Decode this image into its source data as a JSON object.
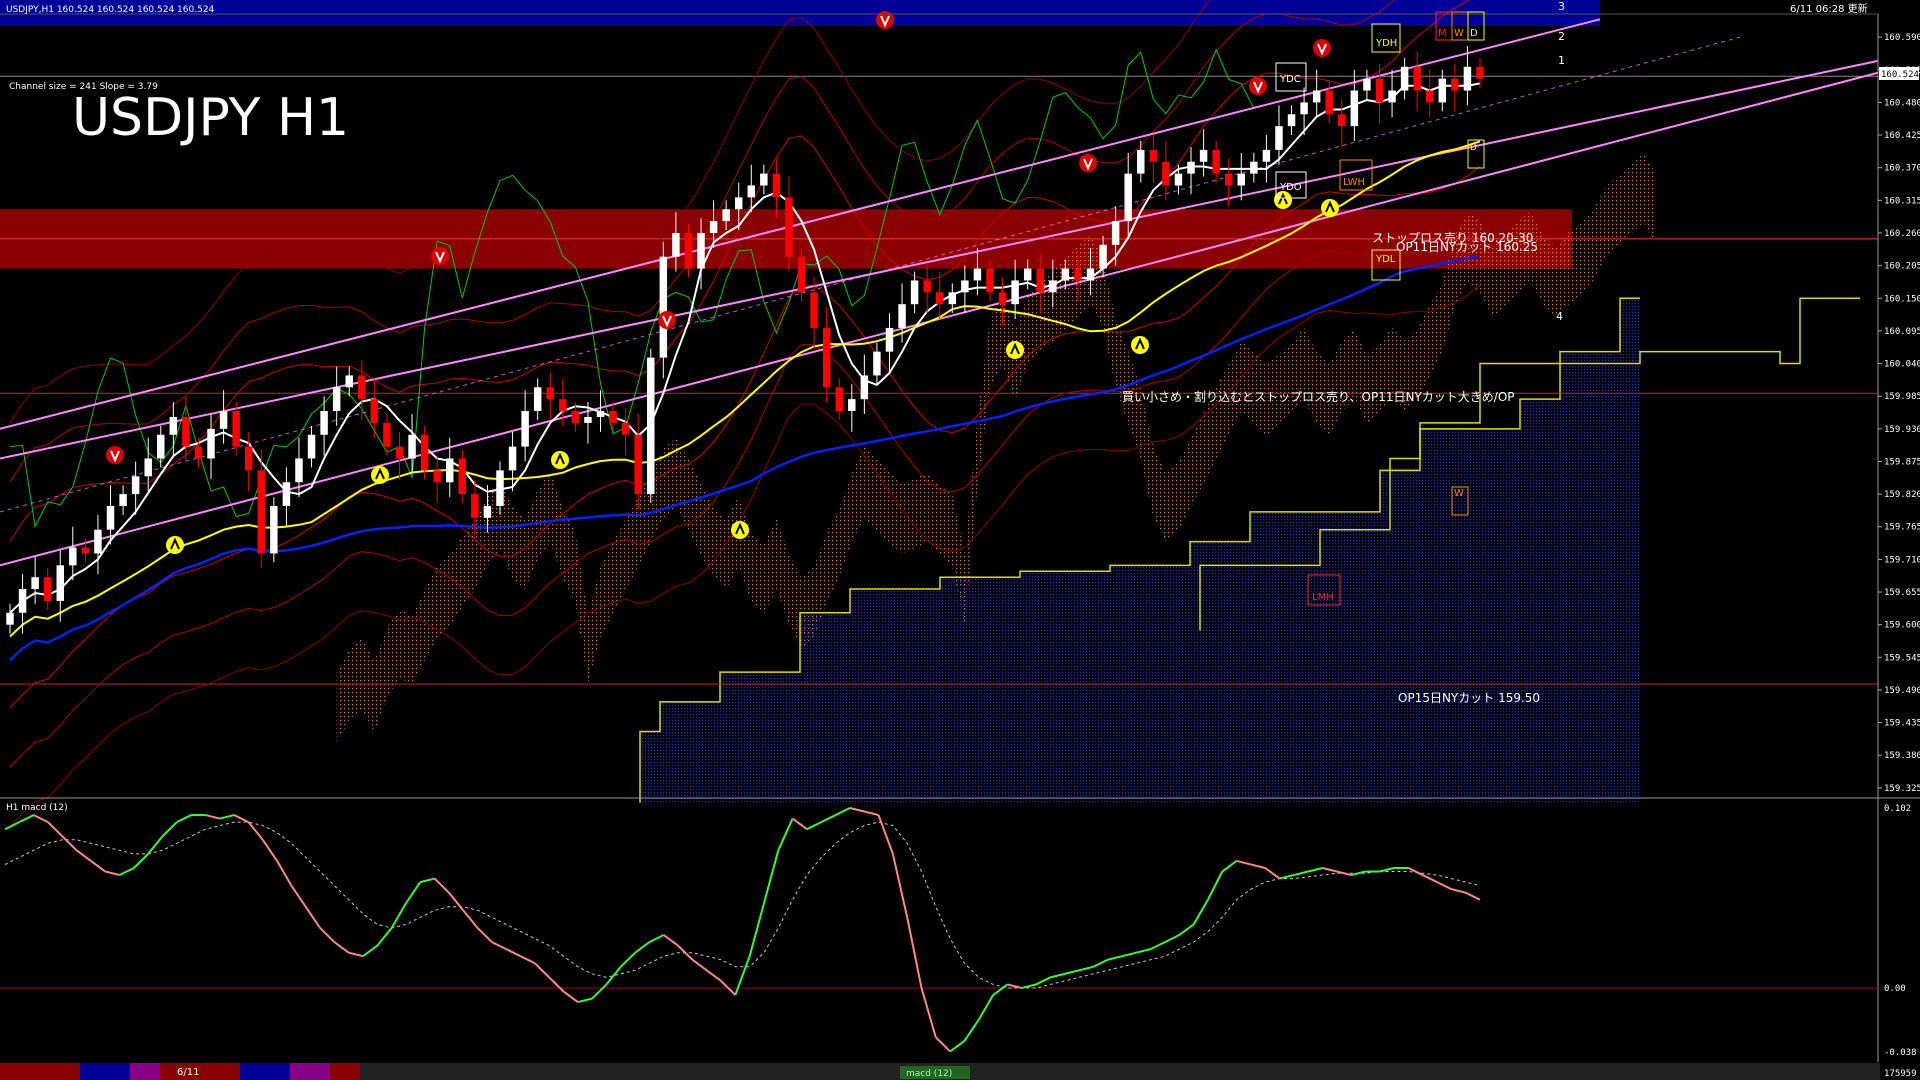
{
  "header": {
    "symbol_info": "USDJPY,H1  160.524 160.524 160.524 160.524",
    "datetime": "6/11 06:28 更新",
    "channel_info": "Channel size = 241 Slope = 3.79",
    "big_title": "USDJPY H1"
  },
  "annotations": {
    "stoploss_sell": "ストップロス売り 160.20-30",
    "op11_cut": "OP11日NYカット 160.25",
    "strategy": "買い小さめ・割り込むとストップロス売り、OP11日NYカット大きめ/OP",
    "op15_cut": "OP15日NYカット 159.50",
    "label_ydh": "YDH",
    "label_ydc": "YDC",
    "label_ydo": "YDO",
    "label_ydl": "YDL",
    "label_lwh": "LWH",
    "label_lmh": "LMH",
    "label_w": "W",
    "label_m": "M",
    "label_d": "D",
    "ch_1": "1",
    "ch_2": "2",
    "ch_3": "3",
    "ch_4": "4"
  },
  "macd_panel": {
    "title": "H1  macd (12)",
    "max_label": "0.102",
    "zero_label": "0.00",
    "min_label": "-0.038",
    "bottom_tab_date": "6/11",
    "bottom_tab_name": "macd (12)",
    "bottom_counter": "175959"
  },
  "colors": {
    "background": "#000000",
    "bull_candle": "#ffffff",
    "bear_candle": "#ff0000",
    "red_zone": "#8b0000",
    "top_bar": "#000099",
    "ma_white": "#ffffff",
    "ma_yellow": "#ffff00",
    "ma_blue": "#0022ff",
    "channel": "#ff88ff",
    "chikou": "#00cc00",
    "kumo_blue": "#1a3aff",
    "kumo_orange": "#ff8844",
    "macd_up": "#33ff33",
    "macd_down": "#ff8888"
  },
  "chart_data": [
    {
      "type": "candlestick",
      "title": "USDJPY H1",
      "ylim": [
        159.3,
        160.62
      ],
      "y_ticks": [
        "160.590",
        "160.535",
        "160.480",
        "160.425",
        "160.370",
        "160.315",
        "160.260",
        "160.205",
        "160.150",
        "160.095",
        "160.040",
        "159.985",
        "159.930",
        "159.875",
        "159.820",
        "159.765",
        "159.710",
        "159.655",
        "159.600",
        "159.545",
        "159.490",
        "159.435",
        "159.380",
        "159.325"
      ],
      "current_price": "160.524",
      "horizontal_levels": [
        {
          "label": "ストップロス売り 160.20-30",
          "from": 160.2,
          "to": 160.3
        },
        {
          "label": "OP11日NYカット 160.25",
          "value": 160.25
        },
        {
          "label": "OP15日NYカット 159.50",
          "value": 159.5
        },
        {
          "label": "",
          "value": 159.99
        }
      ],
      "candles_close": [
        159.62,
        159.66,
        159.68,
        159.64,
        159.7,
        159.73,
        159.72,
        159.76,
        159.8,
        159.82,
        159.85,
        159.88,
        159.92,
        159.95,
        159.9,
        159.88,
        159.93,
        159.96,
        159.9,
        159.86,
        159.72,
        159.8,
        159.84,
        159.88,
        159.92,
        159.96,
        160.0,
        160.02,
        159.98,
        159.94,
        159.9,
        159.88,
        159.92,
        159.86,
        159.84,
        159.88,
        159.82,
        159.78,
        159.8,
        159.86,
        159.9,
        159.96,
        160.0,
        159.98,
        159.96,
        159.94,
        159.95,
        159.96,
        159.94,
        159.92,
        159.82,
        160.05,
        160.22,
        160.26,
        160.2,
        160.26,
        160.28,
        160.3,
        160.32,
        160.34,
        160.36,
        160.32,
        160.22,
        160.16,
        160.1,
        160.0,
        159.96,
        159.98,
        160.02,
        160.06,
        160.1,
        160.14,
        160.18,
        160.16,
        160.14,
        160.16,
        160.18,
        160.2,
        160.16,
        160.14,
        160.18,
        160.2,
        160.16,
        160.18,
        160.2,
        160.18,
        160.2,
        160.24,
        160.28,
        160.36,
        160.4,
        160.38,
        160.34,
        160.36,
        160.38,
        160.4,
        160.36,
        160.34,
        160.36,
        160.38,
        160.4,
        160.44,
        160.46,
        160.48,
        160.5,
        160.46,
        160.44,
        160.5,
        160.52,
        160.48,
        160.5,
        160.54,
        160.5,
        160.48,
        160.52,
        160.5,
        160.54,
        160.52
      ],
      "macd": [
        0.09,
        0.094,
        0.098,
        0.094,
        0.086,
        0.078,
        0.072,
        0.066,
        0.064,
        0.068,
        0.076,
        0.086,
        0.094,
        0.098,
        0.098,
        0.096,
        0.098,
        0.094,
        0.084,
        0.072,
        0.058,
        0.046,
        0.034,
        0.026,
        0.02,
        0.018,
        0.024,
        0.034,
        0.048,
        0.06,
        0.062,
        0.054,
        0.044,
        0.034,
        0.026,
        0.022,
        0.018,
        0.014,
        0.006,
        -0.002,
        -0.008,
        -0.006,
        0.002,
        0.012,
        0.02,
        0.026,
        0.03,
        0.024,
        0.016,
        0.01,
        0.004,
        -0.004,
        0.018,
        0.048,
        0.078,
        0.096,
        0.09,
        0.094,
        0.098,
        0.102,
        0.1,
        0.098,
        0.076,
        0.04,
        0.0,
        -0.028,
        -0.036,
        -0.03,
        -0.018,
        -0.004,
        0.002,
        0.0,
        0.002,
        0.006,
        0.008,
        0.01,
        0.012,
        0.016,
        0.018,
        0.02,
        0.022,
        0.026,
        0.03,
        0.036,
        0.05,
        0.066,
        0.072,
        0.07,
        0.068,
        0.062,
        0.064,
        0.066,
        0.068,
        0.066,
        0.064,
        0.066,
        0.066,
        0.068,
        0.068,
        0.064,
        0.06,
        0.056,
        0.054,
        0.05
      ],
      "macd_signal": [
        0.07,
        0.074,
        0.078,
        0.082,
        0.084,
        0.084,
        0.082,
        0.08,
        0.078,
        0.076,
        0.076,
        0.078,
        0.082,
        0.086,
        0.09,
        0.092,
        0.094,
        0.094,
        0.092,
        0.088,
        0.082,
        0.074,
        0.066,
        0.058,
        0.05,
        0.042,
        0.036,
        0.034,
        0.036,
        0.04,
        0.044,
        0.046,
        0.046,
        0.044,
        0.04,
        0.036,
        0.032,
        0.028,
        0.024,
        0.018,
        0.012,
        0.008,
        0.006,
        0.008,
        0.01,
        0.014,
        0.018,
        0.02,
        0.02,
        0.018,
        0.016,
        0.012,
        0.012,
        0.02,
        0.034,
        0.05,
        0.064,
        0.074,
        0.082,
        0.088,
        0.092,
        0.094,
        0.092,
        0.082,
        0.066,
        0.046,
        0.028,
        0.014,
        0.006,
        0.002,
        0.0,
        0.0,
        0.0,
        0.002,
        0.004,
        0.006,
        0.008,
        0.01,
        0.012,
        0.014,
        0.016,
        0.018,
        0.022,
        0.026,
        0.032,
        0.04,
        0.05,
        0.056,
        0.06,
        0.062,
        0.062,
        0.063,
        0.064,
        0.065,
        0.065,
        0.065,
        0.066,
        0.066,
        0.066,
        0.065,
        0.064,
        0.062,
        0.06,
        0.058
      ]
    }
  ]
}
